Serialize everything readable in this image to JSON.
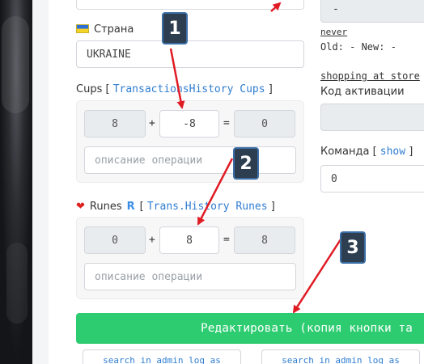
{
  "form": {
    "country_label": "Страна",
    "country_value": "UKRAINE",
    "cups": {
      "label": "Cups",
      "bracket_open": "[",
      "bracket_close": "]",
      "history_link": "TransactionsHistory Cups",
      "current": "8",
      "plus": "+",
      "delta": "-8",
      "equals": "=",
      "result": "0",
      "description_placeholder": "описание операции"
    },
    "runes": {
      "label": "Runes",
      "rune_symbol": "R",
      "bracket_open": "[",
      "bracket_close": "]",
      "history_link": "Trans.History Runes",
      "current": "0",
      "plus": "+",
      "delta": "8",
      "equals": "=",
      "result": "8",
      "description_placeholder": "описание операции"
    },
    "submit_label": "Редактировать (копия кнопки та",
    "search_log_left": "search in admin log as",
    "search_log_right": "search in admin log as"
  },
  "right": {
    "top_value": "-",
    "never_text": "never",
    "old_new_text": "Old: - New: -",
    "shopping_link": "shopping at store",
    "activation_code_label": "Код активации",
    "activation_code_value": "",
    "team_label": "Команда",
    "team_bracket_open": "[",
    "team_show_link": "show",
    "team_bracket_close": "]",
    "team_value": "0"
  },
  "annotations": {
    "badge_1": "1",
    "badge_2": "2",
    "badge_3": "3",
    "arrow_color": "#e01b24"
  },
  "colors": {
    "accent_green": "#2ecc71",
    "link_blue": "#2f7dd1",
    "badge_bg": "#2c3e50"
  }
}
